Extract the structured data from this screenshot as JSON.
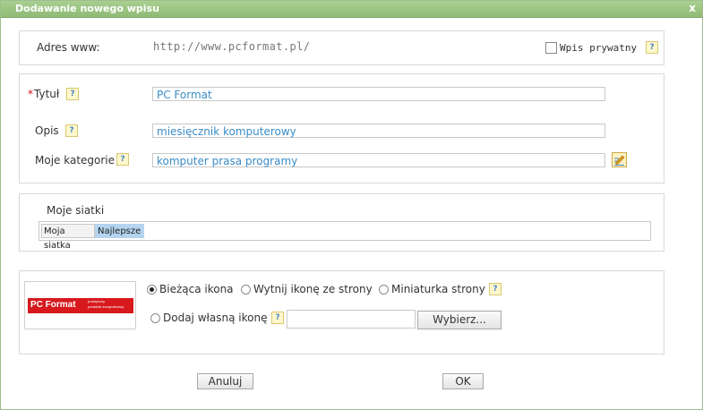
{
  "dialog": {
    "title": "Dodawanie nowego wpisu",
    "close_glyph": "x"
  },
  "url_row": {
    "label": "Adres www:",
    "value": "http://www.pcformat.pl/",
    "private_label": "Wpis prywatny",
    "private_checked": false
  },
  "form": {
    "title_label": "Tytuł",
    "title_required_mark": "*",
    "title_value": "PC Format",
    "desc_label": "Opis",
    "desc_value": "miesięcznik komputerowy",
    "categories_label": "Moje kategorie",
    "categories_value": "komputer prasa programy"
  },
  "grids": {
    "label": "Moje siatki",
    "items": [
      {
        "label": "Moja siatka",
        "selected": false
      },
      {
        "label": "Najlepsze",
        "selected": true
      }
    ]
  },
  "icon": {
    "logo_text": "PC Format",
    "logo_sub1": "praktyczny",
    "logo_sub2": "poradnik komputerowy",
    "options": [
      {
        "label": "Bieżąca ikona",
        "selected": true
      },
      {
        "label": "Wytnij ikonę ze strony",
        "selected": false
      },
      {
        "label": "Miniaturka strony",
        "selected": false
      },
      {
        "label": "Dodaj własną ikonę",
        "selected": false
      }
    ],
    "custom_value": "",
    "browse_label": "Wybierz..."
  },
  "help_glyph": "?",
  "footer": {
    "cancel_label": "Anuluj",
    "ok_label": "OK"
  },
  "colors": {
    "titlebar": "#96c17c",
    "accent_text": "#3a8cc6",
    "selected_chip": "#b4d4ef",
    "logo_red": "#d7191d"
  }
}
